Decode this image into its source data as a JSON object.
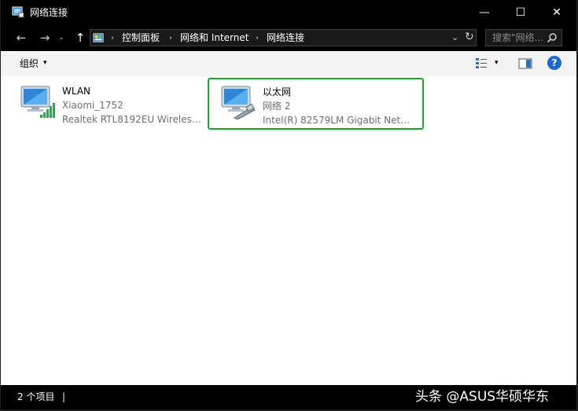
{
  "window": {
    "title": "网络连接",
    "controls": {
      "minimize": "—",
      "maximize": "☐",
      "close": "✕"
    }
  },
  "nav": {
    "back": "←",
    "forward": "→",
    "recent": "⌄",
    "up": "↑"
  },
  "address": {
    "crumbs": [
      "控制面板",
      "网络和 Internet",
      "网络连接"
    ],
    "separator": "›",
    "dropdown": "⌄",
    "refresh": "↻"
  },
  "search": {
    "placeholder": "搜索\"网络..."
  },
  "toolbar": {
    "organize_label": "组织",
    "caret": "▾",
    "help": "?"
  },
  "connections": [
    {
      "name": "WLAN",
      "network": "Xiaomi_1752",
      "device": "Realtek RTL8192EU Wireless L...",
      "icon": "wireless-network-icon"
    },
    {
      "name": "以太网",
      "network": "网络 2",
      "device": "Intel(R) 82579LM Gigabit Netw...",
      "icon": "ethernet-network-icon",
      "selected": true,
      "highlight_color": "#22a52b"
    }
  ],
  "status": {
    "item_count": "2 个项目",
    "separator": "|"
  },
  "watermark": "头条 @ASUS华硕华东",
  "colors": {
    "chrome": "#000000",
    "accent_green": "#22a52b",
    "help_blue": "#1c6ad1"
  }
}
